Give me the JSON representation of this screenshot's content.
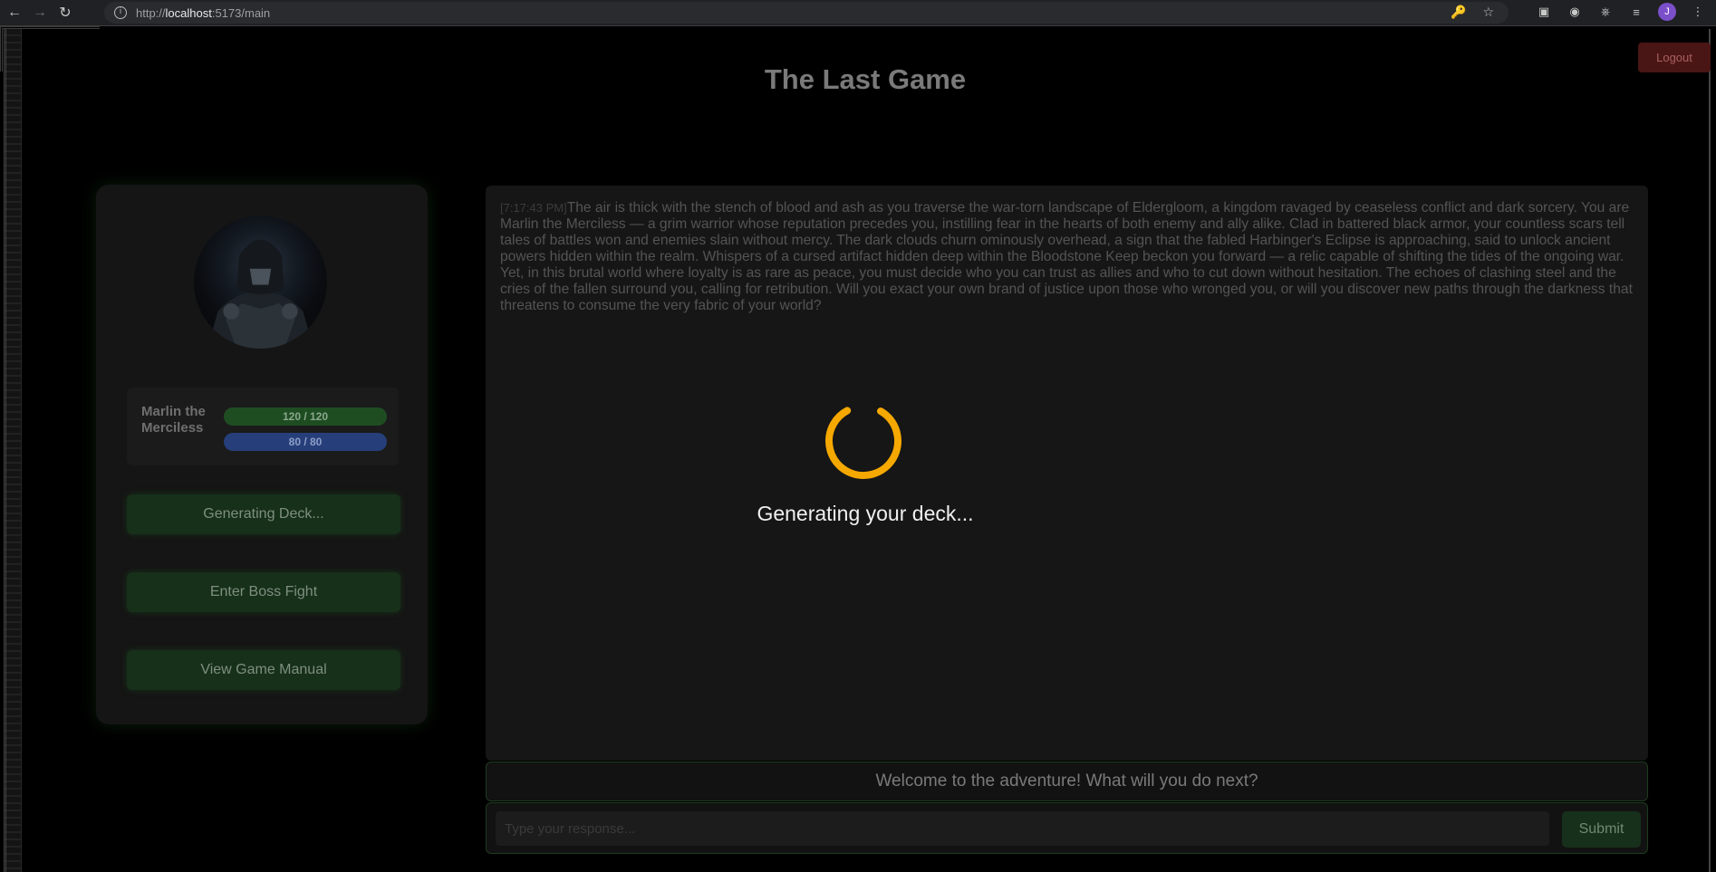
{
  "browser": {
    "url_prefix": "http://",
    "url_host": "localhost",
    "url_path": ":5173/main"
  },
  "app": {
    "title": "The Last Game",
    "logout_label": "Logout"
  },
  "character": {
    "name": "Marlin the Merciless",
    "hp_text": "120 / 120",
    "mp_text": "80 / 80",
    "hp_fraction": 1.0,
    "mp_fraction": 1.0
  },
  "sidebar": {
    "buttons": [
      {
        "label": "Generating Deck..."
      },
      {
        "label": "Enter Boss Fight"
      },
      {
        "label": "View Game Manual"
      }
    ]
  },
  "story": {
    "timestamp": "[7:17:43 PM]",
    "text": "The air is thick with the stench of blood and ash as you traverse the war-torn landscape of Eldergloom, a kingdom ravaged by ceaseless conflict and dark sorcery. You are Marlin the Merciless — a grim warrior whose reputation precedes you, instilling fear in the hearts of both enemy and ally alike. Clad in battered black armor, your countless scars tell tales of battles won and enemies slain without mercy. The dark clouds churn ominously overhead, a sign that the fabled Harbinger's Eclipse is approaching, said to unlock ancient powers hidden within the realm. Whispers of a cursed artifact hidden deep within the Bloodstone Keep beckon you forward — a relic capable of shifting the tides of the ongoing war. Yet, in this brutal world where loyalty is as rare as peace, you must decide who you can trust as allies and who to cut down without hesitation. The echoes of clashing steel and the cries of the fallen surround you, calling for retribution. Will you exact your own brand of justice upon those who wronged you, or will you discover new paths through the darkness that threatens to consume the very fabric of your world?"
  },
  "loading": {
    "text": "Generating your deck...",
    "color": "#f5a800"
  },
  "prompt": {
    "text": "Welcome to the adventure! What will you do next?"
  },
  "input": {
    "placeholder": "Type your response...",
    "submit_label": "Submit"
  }
}
